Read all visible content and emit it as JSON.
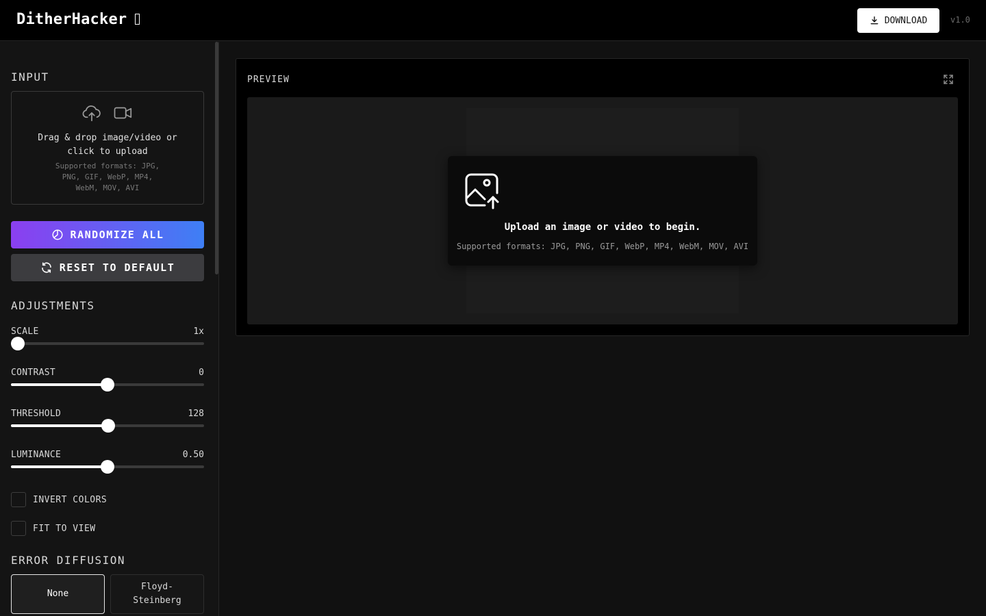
{
  "header": {
    "app_title": "DitherHacker",
    "download_label": "DOWNLOAD",
    "version": "v1.0"
  },
  "sidebar": {
    "input_title": "INPUT",
    "dropzone_main": "Drag & drop image/video or click to upload",
    "dropzone_sub": "Supported formats: JPG, PNG, GIF, WebP, MP4, WebM, MOV, AVI",
    "randomize_label": "RANDOMIZE ALL",
    "reset_label": "RESET TO DEFAULT",
    "adjustments_title": "ADJUSTMENTS",
    "sliders": [
      {
        "label": "SCALE",
        "value": "1x",
        "fraction": 0.035
      },
      {
        "label": "CONTRAST",
        "value": "0",
        "fraction": 0.5
      },
      {
        "label": "THRESHOLD",
        "value": "128",
        "fraction": 0.502
      },
      {
        "label": "LUMINANCE",
        "value": "0.50",
        "fraction": 0.5
      }
    ],
    "checkboxes": [
      {
        "label": "INVERT COLORS",
        "checked": false
      },
      {
        "label": "FIT TO VIEW",
        "checked": false
      }
    ],
    "error_diffusion_title": "ERROR DIFFUSION",
    "diffusion_options": [
      "None",
      "Floyd-\nSteinberg"
    ],
    "diffusion_selected": "None"
  },
  "preview": {
    "title": "PREVIEW",
    "upload_title": "Upload an image or video to begin.",
    "upload_sub": "Supported formats: JPG, PNG, GIF, WebP, MP4, WebM, MOV, AVI"
  }
}
